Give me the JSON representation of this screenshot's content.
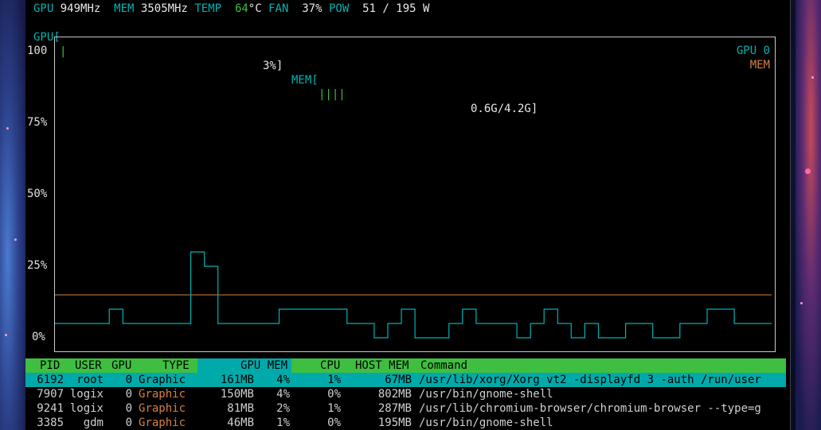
{
  "status": {
    "gpu_label": "GPU",
    "gpu_clock": "949MHz",
    "mem_label": "MEM",
    "mem_clock": "3505MHz",
    "temp_label": "TEMP",
    "temp_value": "64",
    "temp_unit": "°C",
    "fan_label": "FAN",
    "fan_value": "37%",
    "pow_label": "POW",
    "pow_value": "51 / 195 W"
  },
  "meters": {
    "gpu_prefix": "GPU[",
    "gpu_bar": "|",
    "gpu_value": "3%]",
    "mem_prefix": "MEM[",
    "mem_bar": "||||",
    "mem_value": "0.6G/4.2G]"
  },
  "chart_data": {
    "type": "line",
    "y_ticks": [
      "100",
      "75%",
      "50%",
      "25%",
      "0%"
    ],
    "ylim": [
      0,
      100
    ],
    "legend_position": "top-right",
    "series": [
      {
        "name": "GPU 0",
        "color": "#00b3b3",
        "values": [
          5,
          5,
          5,
          5,
          5,
          5,
          5,
          5,
          5,
          5,
          5,
          5,
          5,
          5,
          5,
          5,
          10,
          10,
          10,
          10,
          5,
          5,
          5,
          5,
          5,
          5,
          5,
          5,
          5,
          5,
          5,
          5,
          5,
          5,
          5,
          5,
          5,
          5,
          5,
          5,
          30,
          30,
          30,
          30,
          25,
          25,
          25,
          25,
          5,
          5,
          5,
          5,
          5,
          5,
          5,
          5,
          5,
          5,
          5,
          5,
          5,
          5,
          5,
          5,
          5,
          5,
          10,
          10,
          10,
          10,
          10,
          10,
          10,
          10,
          10,
          10,
          10,
          10,
          10,
          10,
          10,
          10,
          10,
          10,
          10,
          10,
          5,
          5,
          5,
          5,
          5,
          5,
          5,
          5,
          0,
          0,
          0,
          0,
          5,
          5,
          5,
          5,
          10,
          10,
          10,
          10,
          0,
          0,
          0,
          0,
          0,
          0,
          0,
          0,
          0,
          0,
          5,
          5,
          5,
          5,
          10,
          10,
          10,
          10,
          5,
          5,
          5,
          5,
          5,
          5,
          5,
          5,
          5,
          5,
          5,
          5,
          0,
          0,
          0,
          0,
          5,
          5,
          5,
          5,
          10,
          10,
          10,
          10,
          5,
          5,
          5,
          5,
          0,
          0,
          0,
          0,
          5,
          5,
          5,
          5,
          0,
          0,
          0,
          0,
          0,
          0,
          0,
          0,
          5,
          5,
          5,
          5,
          5,
          5,
          5,
          5,
          0,
          0,
          0,
          0,
          0,
          0,
          0,
          0,
          5,
          5,
          5,
          5,
          5,
          5,
          5,
          5,
          10,
          10,
          10,
          10,
          10,
          10,
          10,
          10,
          5,
          5,
          5,
          5,
          5,
          5,
          5,
          5,
          5,
          5,
          5
        ]
      },
      {
        "name": "MEM",
        "color": "#d6813d",
        "values": [
          15,
          15
        ]
      }
    ]
  },
  "table": {
    "headers": {
      "pid": "PID",
      "user": "USER",
      "gpu": "GPU",
      "type": "TYPE",
      "gpu_mem": "GPU MEM",
      "cpu": "CPU",
      "host_mem": "HOST MEM",
      "command": "Command"
    },
    "rows": [
      {
        "pid": "6192",
        "user": "root",
        "gpu": "0",
        "type": "Graphic",
        "gpu_mem": "161MB",
        "mem_pct": "4%",
        "cpu": "1%",
        "host_mem": "67MB",
        "command": "/usr/lib/xorg/Xorg vt2 -displayfd 3 -auth /run/user"
      },
      {
        "pid": "7907",
        "user": "logix",
        "gpu": "0",
        "type": "Graphic",
        "gpu_mem": "150MB",
        "mem_pct": "4%",
        "cpu": "0%",
        "host_mem": "802MB",
        "command": "/usr/bin/gnome-shell"
      },
      {
        "pid": "9241",
        "user": "logix",
        "gpu": "0",
        "type": "Graphic",
        "gpu_mem": "81MB",
        "mem_pct": "2%",
        "cpu": "1%",
        "host_mem": "287MB",
        "command": "/usr/lib/chromium-browser/chromium-browser --type=g"
      },
      {
        "pid": "3385",
        "user": "gdm",
        "gpu": "0",
        "type": "Graphic",
        "gpu_mem": "46MB",
        "mem_pct": "1%",
        "cpu": "0%",
        "host_mem": "195MB",
        "command": "/usr/bin/gnome-shell"
      }
    ]
  }
}
